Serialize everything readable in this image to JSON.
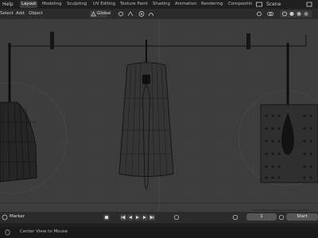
{
  "topbar": {
    "menus": [
      "Help"
    ],
    "workspaces": [
      "Layout",
      "Modeling",
      "Sculpting",
      "UV Editing",
      "Texture Paint",
      "Shading",
      "Animation",
      "Rendering",
      "Compositin"
    ],
    "scene_label": "Scene"
  },
  "header": {
    "menus": [
      "Select",
      "Add",
      "Object"
    ],
    "transform_orientation": "Global"
  },
  "timeline": {
    "marker_label": "Marker",
    "current_frame": "1",
    "start_label": "Start"
  },
  "statusbar": {
    "hint": "Center View to Mouse"
  },
  "icons": [
    "view-icon",
    "cursor-icon",
    "orientation-icon",
    "pivot-icon",
    "snap-icon",
    "proportional-icon",
    "play-icon",
    "rewind-icon",
    "jump-start-icon",
    "jump-end-icon",
    "record-icon",
    "keyframe-icon",
    "gizmo-icon",
    "overlay-icon",
    "shading-icon"
  ]
}
